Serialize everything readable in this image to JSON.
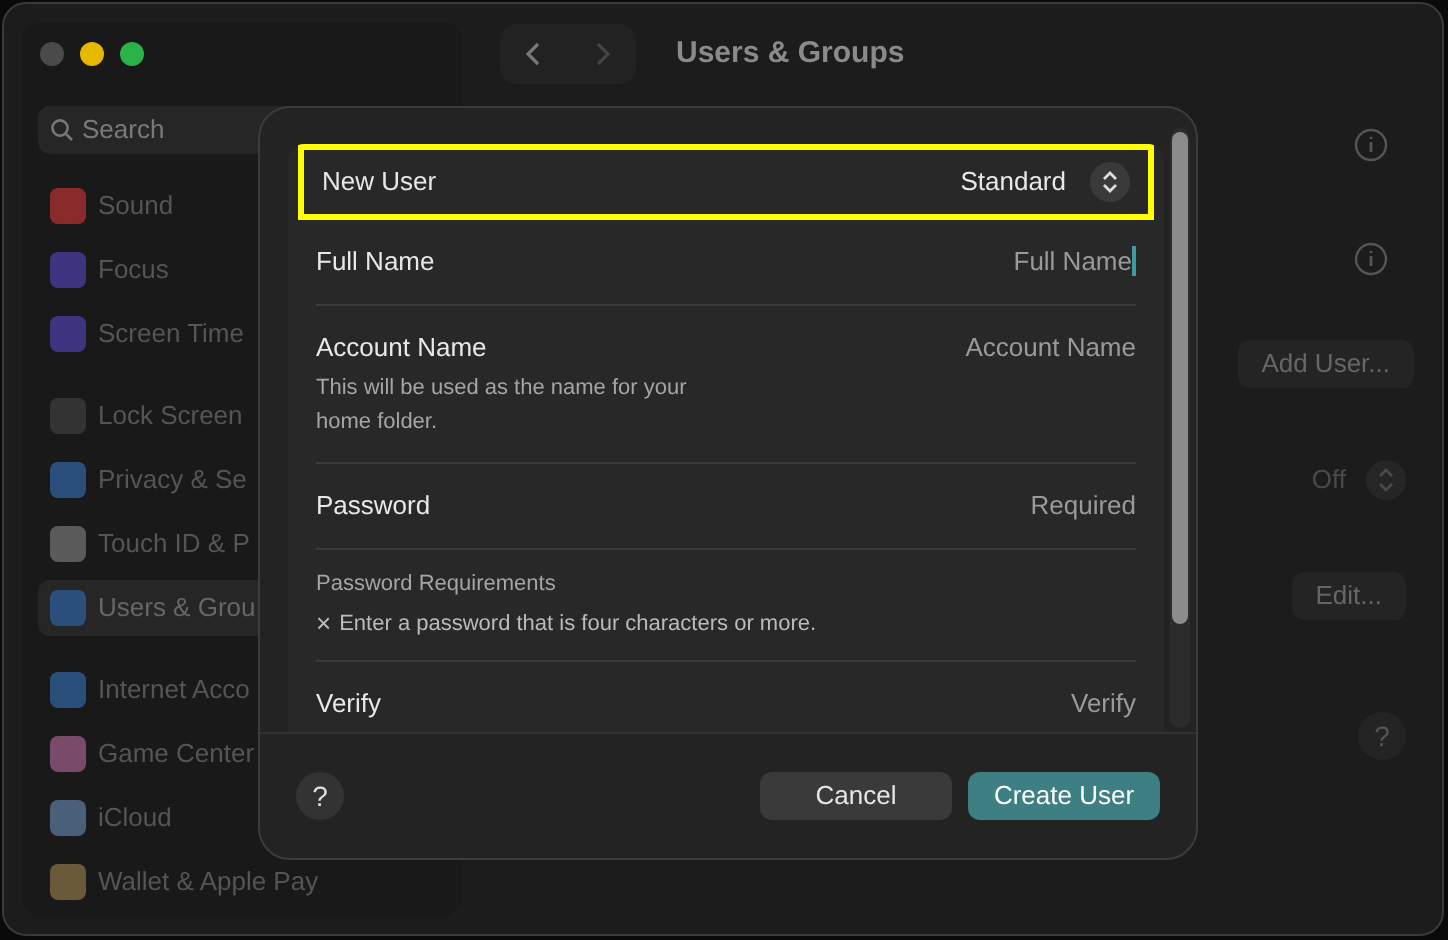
{
  "window": {
    "title": "Users & Groups"
  },
  "sidebar": {
    "search": {
      "placeholder": "Search"
    },
    "groups": [
      [
        {
          "label": "Sound",
          "color": "#8a2a2a",
          "selected": false
        },
        {
          "label": "Focus",
          "color": "#3e3580",
          "selected": false
        },
        {
          "label": "Screen Time",
          "color": "#3e3580",
          "selected": false
        }
      ],
      [
        {
          "label": "Lock Screen",
          "color": "#333333",
          "selected": false
        },
        {
          "label": "Privacy & Se",
          "color": "#2a4f7a",
          "selected": false
        },
        {
          "label": "Touch ID & P",
          "color": "#5a5a5a",
          "selected": false
        },
        {
          "label": "Users & Grou",
          "color": "#2a4f7a",
          "selected": true
        }
      ],
      [
        {
          "label": "Internet Acco",
          "color": "#2a4f7a",
          "selected": false
        },
        {
          "label": "Game Center",
          "color": "#7a4a6a",
          "selected": false
        },
        {
          "label": "iCloud",
          "color": "#4a5f7a",
          "selected": false
        },
        {
          "label": "Wallet & Apple Pay",
          "color": "#6a5a3a",
          "selected": false
        }
      ]
    ]
  },
  "content": {
    "add_user_button": "Add User...",
    "auto_login_value": "Off",
    "edit_button": "Edit...",
    "help_button": "?"
  },
  "dialog": {
    "rows": [
      {
        "kind": "popup",
        "label": "New User",
        "value": "Standard",
        "highlighted": true
      },
      {
        "kind": "field",
        "label": "Full Name",
        "placeholder": "Full Name",
        "focused": true
      },
      {
        "kind": "field",
        "label": "Account Name",
        "placeholder": "Account Name",
        "note": "This will be used as the name for your home folder.",
        "focused": false
      },
      {
        "kind": "field",
        "label": "Password",
        "placeholder": "Required",
        "focused": false
      },
      {
        "kind": "requirements",
        "title": "Password Requirements",
        "mark": "×",
        "text": "Enter a password that is four characters or more."
      },
      {
        "kind": "field",
        "label": "Verify",
        "placeholder": "Verify",
        "focused": false
      }
    ],
    "help_button": "?",
    "cancel_button": "Cancel",
    "create_button": "Create User"
  }
}
